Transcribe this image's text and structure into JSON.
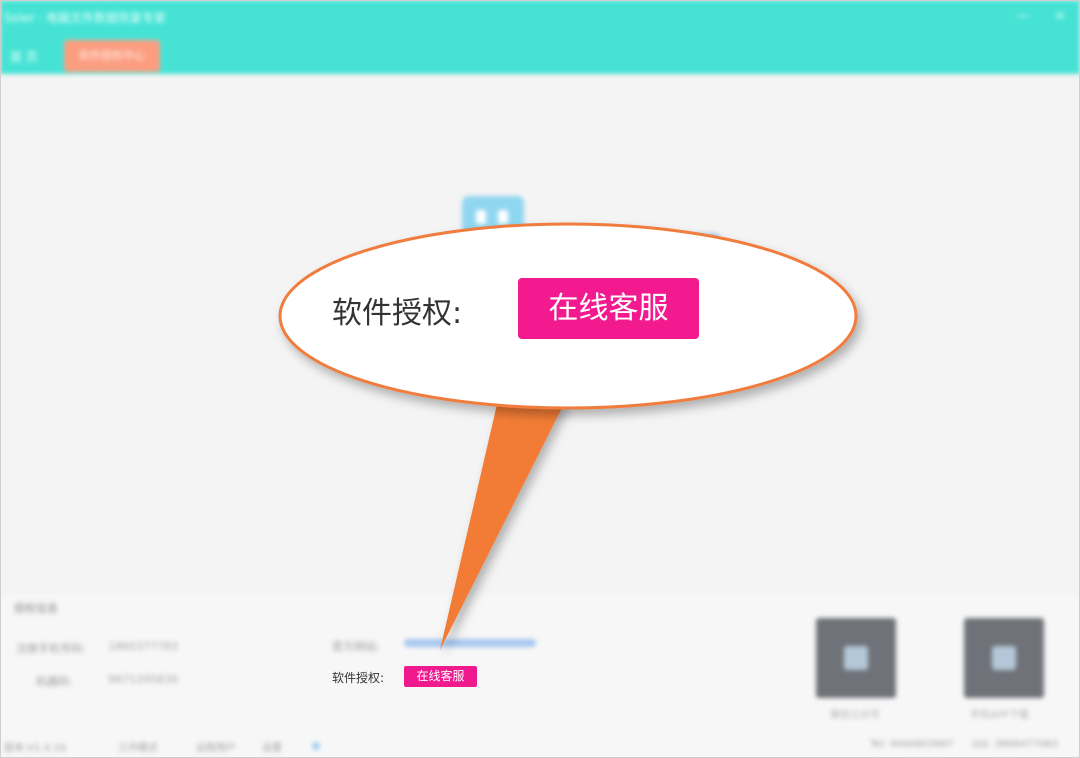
{
  "app": {
    "title_blurred": "Soler · 电脑文件数据恢复专家",
    "tab_home": "首 页",
    "tab_active": "软件授权中心"
  },
  "window_controls": {
    "minimize": "—",
    "close": "×"
  },
  "info": {
    "section_title": "授权信息",
    "phone_label": "注册手机号码:",
    "phone_value": "1860377783",
    "code_label": "机器码:",
    "code_value": "9871295830",
    "website_label": "官方网站:",
    "license_label": "软件授权:",
    "service_button": "在线客服"
  },
  "qr_codes": [
    {
      "caption": "微信公众号"
    },
    {
      "caption": "手机APP下载"
    }
  ],
  "statusbar": {
    "version": "版本:V1.4.16",
    "item2": "工作模式",
    "item3": "远程用户",
    "item4": "设置",
    "right1": "Tel: 4000803987",
    "right2": "QQ: 3868477983"
  },
  "callout": {
    "license_label": "软件授权:",
    "service_button": "在线客服"
  },
  "colors": {
    "titlebar": "#46e3d5",
    "active_tab": "#fc9d80",
    "service_button": "#f21a8e",
    "callout_outline": "#f07c3c",
    "callout_pointer": "#f27b35"
  }
}
